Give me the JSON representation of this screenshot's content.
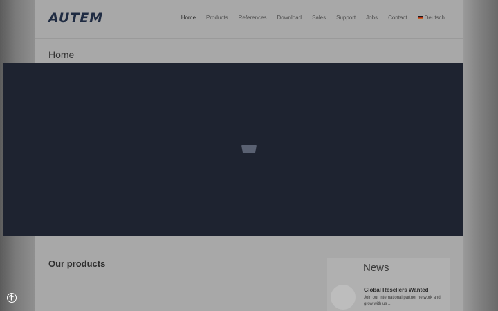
{
  "header": {
    "logo_text": "AUTEM",
    "nav": [
      {
        "label": "Home",
        "active": true
      },
      {
        "label": "Products",
        "active": false
      },
      {
        "label": "References",
        "active": false
      },
      {
        "label": "Download",
        "active": false
      },
      {
        "label": "Sales",
        "active": false
      },
      {
        "label": "Support",
        "active": false
      },
      {
        "label": "Jobs",
        "active": false
      },
      {
        "label": "Contact",
        "active": false
      },
      {
        "label": "Deutsch",
        "active": false,
        "icon": "german-flag-icon"
      }
    ]
  },
  "main": {
    "page_title": "Home",
    "products_heading": "Our products"
  },
  "overlay": {
    "loader_icon": "loading-tray-icon",
    "background_color": "#1e2330"
  },
  "news": {
    "heading": "News",
    "items": [
      {
        "title": "Global Resellers Wanted",
        "text": "Join our international partner network and grow with us ..."
      }
    ]
  },
  "floating": {
    "scroll_top_icon": "arrow-up-circle-icon"
  },
  "colors": {
    "brand": "#1f2b42"
  }
}
